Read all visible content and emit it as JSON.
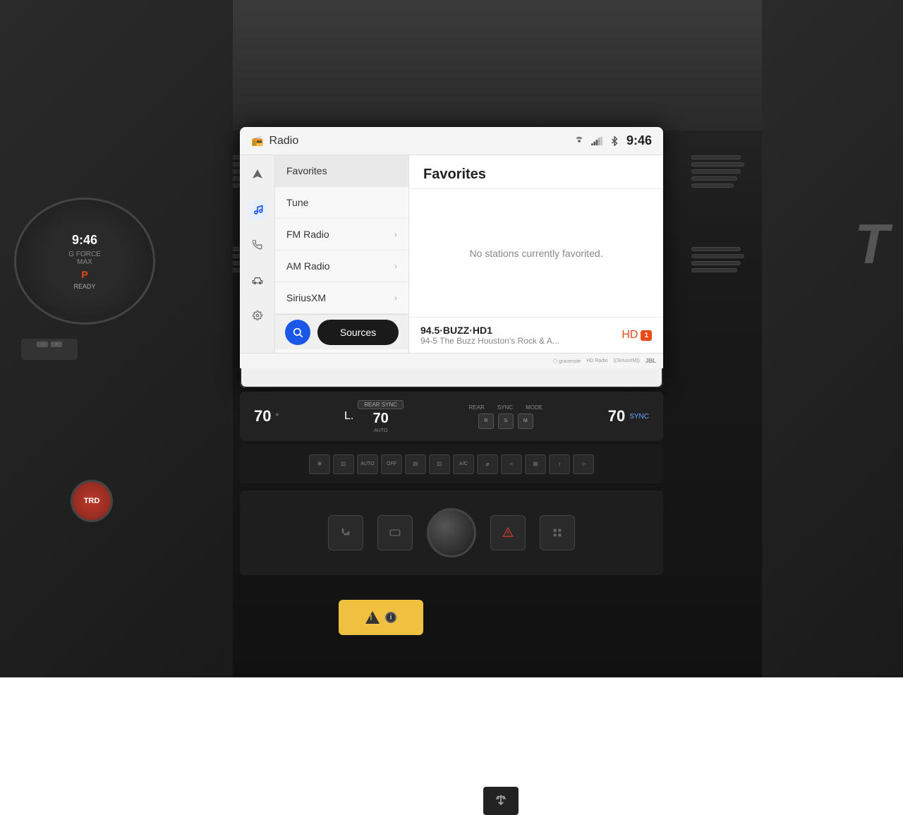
{
  "scene": {
    "background_color": "#1a1a1a"
  },
  "screen": {
    "header": {
      "title": "Radio",
      "time": "9:46",
      "radio_icon": "📻",
      "icons": [
        "sound-icon",
        "antenna-icon",
        "bluetooth-icon"
      ]
    },
    "nav": {
      "items": [
        {
          "name": "navigation",
          "icon": "▲",
          "active": false
        },
        {
          "name": "music",
          "icon": "♪",
          "active": true
        },
        {
          "name": "phone",
          "icon": "✆",
          "active": false
        },
        {
          "name": "vehicle",
          "icon": "🚗",
          "active": false
        },
        {
          "name": "settings",
          "icon": "⚙",
          "active": false
        }
      ]
    },
    "menu": {
      "items": [
        {
          "label": "Favorites",
          "has_arrow": false,
          "active": true
        },
        {
          "label": "Tune",
          "has_arrow": false,
          "active": false
        },
        {
          "label": "FM Radio",
          "has_arrow": true,
          "active": false
        },
        {
          "label": "AM Radio",
          "has_arrow": true,
          "active": false
        },
        {
          "label": "SiriusXM",
          "has_arrow": true,
          "active": false
        }
      ]
    },
    "bottom_bar": {
      "search_label": "Search",
      "sources_label": "Sources"
    },
    "content": {
      "title": "Favorites",
      "empty_message": "No stations currently favorited.",
      "now_playing": {
        "station": "94.5·BUZZ·HD1",
        "description": "94-5 The Buzz Houston's Rock & A...",
        "badge": "HD 1"
      }
    },
    "footer": {
      "logos": [
        "gracenote",
        "HD Radio",
        "SiriusXM",
        "JBL"
      ]
    }
  },
  "hvac": {
    "left_temp": "70",
    "right_temp": "70",
    "left_unit": "°",
    "right_unit": "°SYNC",
    "fan_label": "L.",
    "rear_sync_label": "REAR SYNC",
    "rear_label": "REAR",
    "sync_label": "SYNC",
    "mode_label": "MODE",
    "auto_label": "AUTO",
    "off_label": "OFF",
    "ac_label": "A/C"
  },
  "gauge": {
    "time": "9:46",
    "mode": "P"
  },
  "trd": {
    "label": "TRD"
  }
}
